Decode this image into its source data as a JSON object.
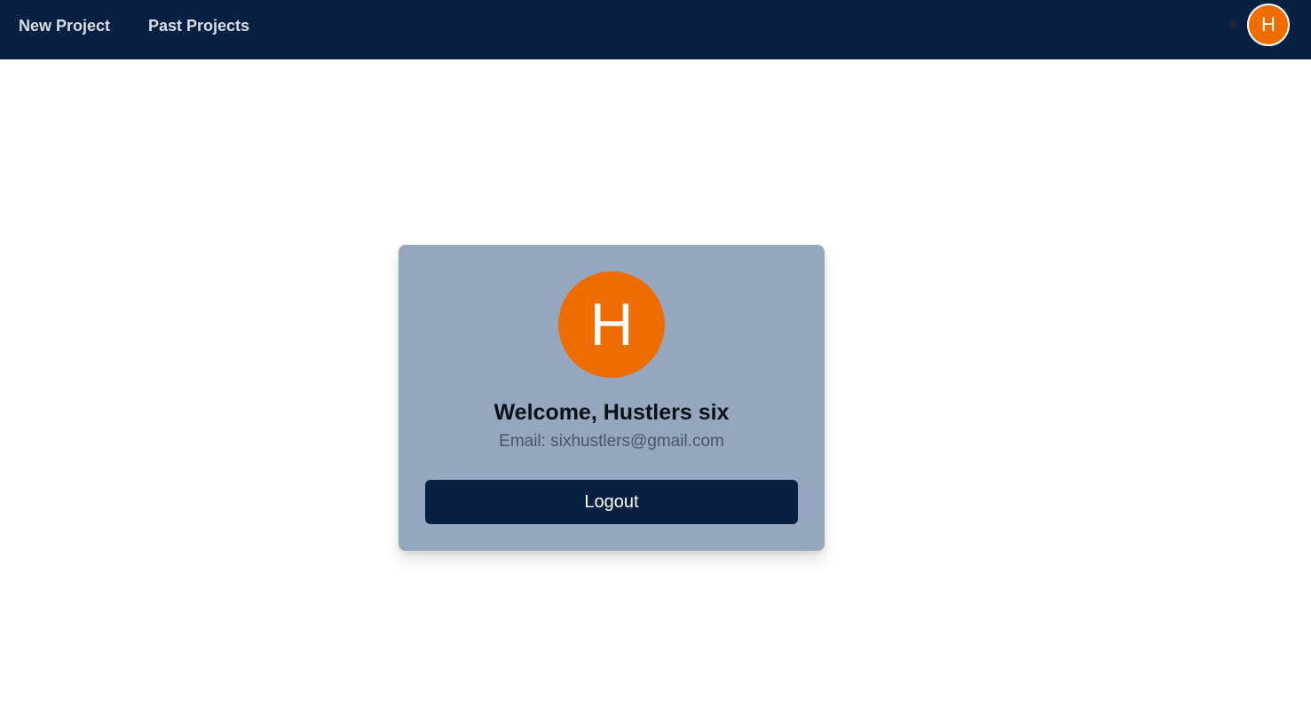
{
  "nav": {
    "new_project_label": "New Project",
    "past_projects_label": "Past Projects",
    "avatar_initial": "H"
  },
  "profile": {
    "avatar_initial": "H",
    "welcome_text": "Welcome, Hustlers six",
    "email_label": "Email:",
    "email": "sixhustlers@gmail.com",
    "logout_label": "Logout"
  },
  "colors": {
    "navbar_bg": "#082042",
    "avatar_orange": "#ef6c00",
    "card_bg": "#95a7be",
    "button_bg": "#082042"
  }
}
